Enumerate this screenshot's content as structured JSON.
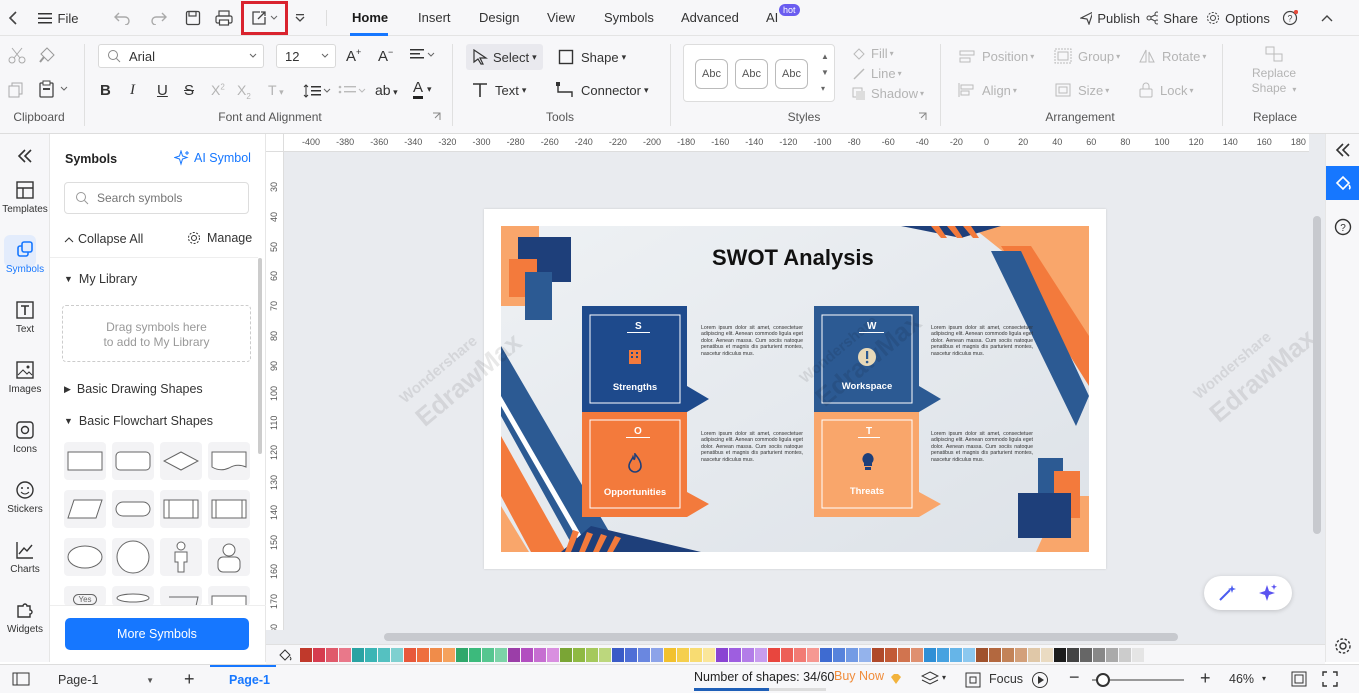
{
  "menu": {
    "back": "‹",
    "file": "File",
    "tabs": [
      "Home",
      "Insert",
      "Design",
      "View",
      "Symbols",
      "Advanced",
      "AI"
    ],
    "ai_badge": "hot",
    "publish": "Publish",
    "share": "Share",
    "options": "Options"
  },
  "font": {
    "family": "Arial",
    "size": "12"
  },
  "ribbon": {
    "select": "Select",
    "shape": "Shape",
    "text": "Text",
    "connector": "Connector",
    "style_sample": "Abc",
    "fill": "Fill",
    "line": "Line",
    "shadow": "Shadow",
    "position": "Position",
    "group": "Group",
    "rotate": "Rotate",
    "align": "Align",
    "size": "Size",
    "lock": "Lock",
    "replace_shape_1": "Replace",
    "replace_shape_2": "Shape",
    "groups": [
      "Clipboard",
      "Font and Alignment",
      "Tools",
      "Styles",
      "Arrangement",
      "Replace"
    ]
  },
  "rail": [
    "Templates",
    "Symbols",
    "Text",
    "Images",
    "Icons",
    "Stickers",
    "Charts",
    "Widgets"
  ],
  "symbols": {
    "title": "Symbols",
    "ai_symbol": "AI Symbol",
    "search_placeholder": "Search symbols",
    "collapse_all": "Collapse All",
    "manage": "Manage",
    "my_library": "My Library",
    "drag_hint_1": "Drag symbols here",
    "drag_hint_2": "to add to My Library",
    "basic_drawing": "Basic Drawing Shapes",
    "basic_flowchart": "Basic Flowchart Shapes",
    "more": "More Symbols",
    "yes_label": "Yes"
  },
  "ruler": {
    "h": [
      "-400",
      "-380",
      "-360",
      "-340",
      "-320",
      "-300",
      "-280",
      "-260",
      "-240",
      "-220",
      "-200",
      "-180",
      "-160",
      "-140",
      "-120",
      "-100",
      "-80",
      "-60",
      "-40",
      "-20",
      "0",
      "20",
      "40",
      "60",
      "80",
      "100",
      "120",
      "140",
      "160",
      "180"
    ],
    "v": [
      "30",
      "40",
      "50",
      "60",
      "70",
      "80",
      "90",
      "100",
      "110",
      "120",
      "130",
      "140",
      "150",
      "160",
      "170",
      "180"
    ]
  },
  "slide": {
    "title": "SWOT Analysis",
    "watermark_1": "Wondershare",
    "watermark_2": "EdrawMax",
    "quads": [
      {
        "letter": "S",
        "label": "Strengths",
        "color": "#1e4a8c",
        "text": "Lorem ipsum dolor sit amet, consectetuer adipiscing elit. Aenean commodo ligula eget dolor. Aenean massa. Cum sociis natoque penatibus et magnis dis parturient montes, nascetur ridiculus mus."
      },
      {
        "letter": "W",
        "label": "Workspace",
        "color": "#2c5a93",
        "text": "Lorem ipsum dolor sit amet, consectetuer adipiscing elit. Aenean commodo ligula eget dolor. Aenean massa. Cum sociis natoque penatibus et magnis dis parturient montes, nascetur ridiculus mus."
      },
      {
        "letter": "O",
        "label": "Opportunities",
        "color": "#f37a3c",
        "text": "Lorem ipsum dolor sit amet, consectetuer adipiscing elit. Aenean commodo ligula eget dolor. Aenean massa. Cum sociis natoque penatibus et magnis dis parturient montes, nascetur ridiculus mus."
      },
      {
        "letter": "T",
        "label": "Threats",
        "color": "#f9a66b",
        "text": "Lorem ipsum dolor sit amet, consectetuer adipiscing elit. Aenean commodo ligula eget dolor. Aenean massa. Cum sociis natoque penatibus et magnis dis parturient montes, nascetur ridiculus mus."
      }
    ]
  },
  "palette": [
    "#c0392b",
    "#d63c4e",
    "#e05a6b",
    "#e9788a",
    "#2aa3a3",
    "#3bb5b5",
    "#55c1c1",
    "#7fd0d0",
    "#e8583a",
    "#ee6e3e",
    "#f08c4a",
    "#f5a25d",
    "#2fa86b",
    "#3cba7c",
    "#56c690",
    "#7cd3a8",
    "#9b3ea8",
    "#b24ec0",
    "#c66ed1",
    "#d98fe0",
    "#7aa535",
    "#8fb943",
    "#a5c95c",
    "#bcd77d",
    "#3a5bc7",
    "#4f6fd6",
    "#6a87e0",
    "#8ca3e9",
    "#f2c12e",
    "#f5cf4e",
    "#f8dc72",
    "#fae69a",
    "#8a44d3",
    "#9e5ee0",
    "#b37de8",
    "#c89cef",
    "#e8463e",
    "#ed5f57",
    "#f27b74",
    "#f69892",
    "#3e6bd1",
    "#5783dc",
    "#739be5",
    "#94b3ec",
    "#b0492a",
    "#c25a36",
    "#d1744f",
    "#df9070",
    "#2f8fd6",
    "#47a2e0",
    "#66b5e8",
    "#8cc8ef",
    "#a0522d",
    "#b3683f",
    "#c38358",
    "#d3a07a",
    "#e0c8a8",
    "#eadbc2",
    "#1c1c1c",
    "#444",
    "#666",
    "#888",
    "#aaa",
    "#ccc",
    "#e5e5e5"
  ],
  "status": {
    "page_select": "Page-1",
    "page_tab": "Page-1",
    "shapes": "Number of shapes: 34/60",
    "buy_now": "Buy Now",
    "focus": "Focus",
    "zoom": "46%"
  },
  "colors": {
    "accent": "#1677ff",
    "blue": "#1e4a8c",
    "orange": "#f37a3c",
    "light_orange": "#f9a66b"
  }
}
